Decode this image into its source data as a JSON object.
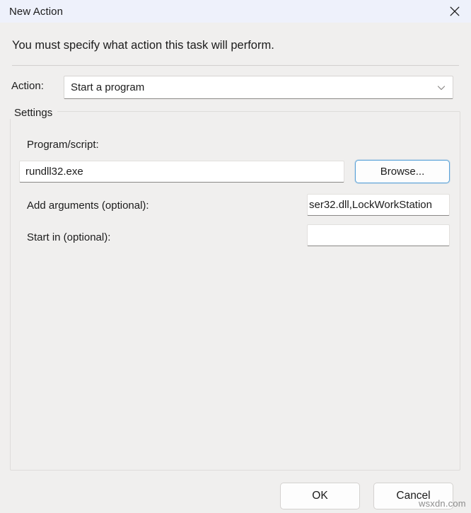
{
  "window": {
    "title": "New Action",
    "close_icon": "close-icon"
  },
  "header": {
    "instruction": "You must specify what action this task will perform."
  },
  "action_row": {
    "label": "Action:",
    "selected_value": "Start a program",
    "chevron_icon": "chevron-down-icon",
    "options": [
      "Start a program"
    ]
  },
  "settings": {
    "legend": "Settings",
    "program": {
      "label": "Program/script:",
      "value": "rundll32.exe",
      "placeholder": ""
    },
    "browse": {
      "label": "Browse..."
    },
    "arguments": {
      "label": "Add arguments (optional):",
      "value": "ser32.dll,LockWorkStation",
      "placeholder": ""
    },
    "start_in": {
      "label": "Start in (optional):",
      "value": "",
      "placeholder": ""
    }
  },
  "footer": {
    "ok_label": "OK",
    "cancel_label": "Cancel"
  },
  "watermark": {
    "text": "wsxdn.com"
  },
  "colors": {
    "titlebar_bg": "#eef1fb",
    "dialog_bg": "#f0efee",
    "accent_focus": "#5aa2d8",
    "text": "#1c1c1c",
    "field_bg": "#ffffff",
    "field_underline": "#8a8886",
    "group_border": "#dedcda",
    "watermark": "#8d8d8d"
  }
}
